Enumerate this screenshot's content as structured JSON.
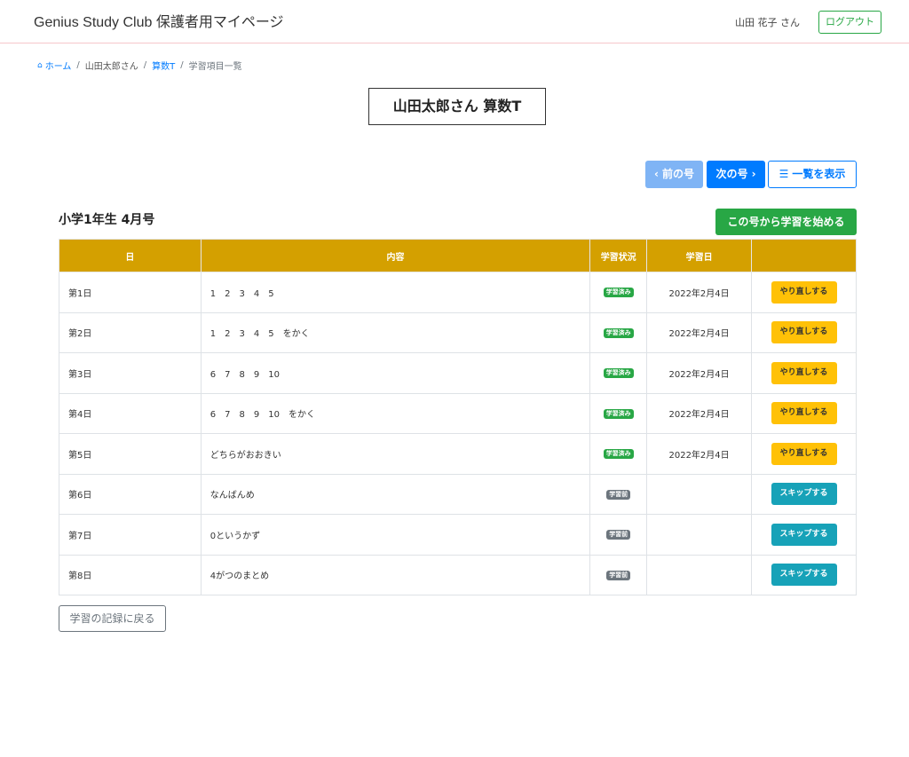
{
  "header": {
    "brand": "Genius Study Club 保護者用マイページ",
    "user_name": "山田 花子 さん",
    "logout_label": "ログアウト"
  },
  "breadcrumb": {
    "home_icon": "home-icon",
    "items": [
      {
        "label": "ホーム",
        "link": true
      },
      {
        "label": "山田太郎さん",
        "link": false
      },
      {
        "label": "算数T",
        "link": true
      },
      {
        "label": "学習項目一覧",
        "link": false
      }
    ],
    "separator": "/"
  },
  "page_title": "山田太郎さん 算数T",
  "nav": {
    "prev_label": "‹ 前の号",
    "next_label": "次の号 ›",
    "list_label": "一覧を表示",
    "list_icon": "list-icon"
  },
  "section": {
    "title": "小学1年生 4月号",
    "start_label": "この号から学習を始める"
  },
  "table": {
    "headers": [
      "日",
      "内容",
      "学習状況",
      "学習日",
      ""
    ],
    "rows": [
      {
        "day": "第1日",
        "content": "1　2　3　4　5",
        "status": "学習済み",
        "status_type": "done",
        "date": "2022年2月4日",
        "action": "やり直しする",
        "action_type": "redo"
      },
      {
        "day": "第2日",
        "content": "1　2　3　4　5　をかく",
        "status": "学習済み",
        "status_type": "done",
        "date": "2022年2月4日",
        "action": "やり直しする",
        "action_type": "redo"
      },
      {
        "day": "第3日",
        "content": "6　7　8　9　10",
        "status": "学習済み",
        "status_type": "done",
        "date": "2022年2月4日",
        "action": "やり直しする",
        "action_type": "redo"
      },
      {
        "day": "第4日",
        "content": "6　7　8　9　10　をかく",
        "status": "学習済み",
        "status_type": "done",
        "date": "2022年2月4日",
        "action": "やり直しする",
        "action_type": "redo"
      },
      {
        "day": "第5日",
        "content": "どちらがおおきい",
        "status": "学習済み",
        "status_type": "done",
        "date": "2022年2月4日",
        "action": "やり直しする",
        "action_type": "redo"
      },
      {
        "day": "第6日",
        "content": "なんばんめ",
        "status": "学習前",
        "status_type": "pending",
        "date": "",
        "action": "スキップする",
        "action_type": "skip"
      },
      {
        "day": "第7日",
        "content": "0というかず",
        "status": "学習前",
        "status_type": "pending",
        "date": "",
        "action": "スキップする",
        "action_type": "skip"
      },
      {
        "day": "第8日",
        "content": "4がつのまとめ",
        "status": "学習前",
        "status_type": "pending",
        "date": "",
        "action": "スキップする",
        "action_type": "skip"
      }
    ]
  },
  "back_label": "学習の記録に戻る",
  "colors": {
    "primary": "#007bff",
    "success": "#28a745",
    "warning": "#ffc107",
    "info": "#17a2b8",
    "secondary": "#6c757d",
    "table_header": "#d4a000"
  }
}
